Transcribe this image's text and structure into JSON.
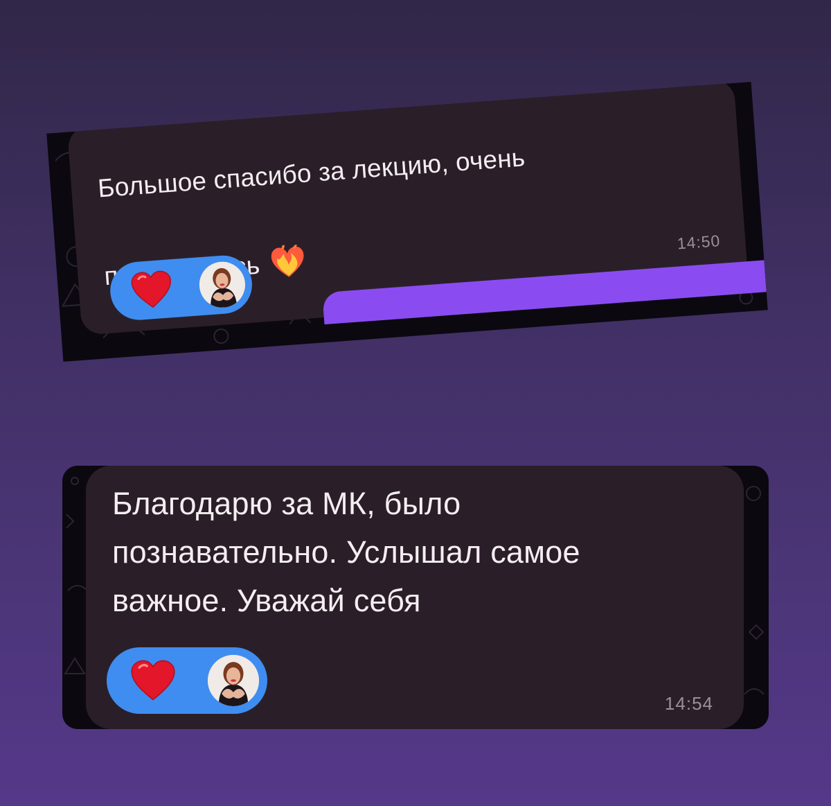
{
  "colors": {
    "background_top": "#312748",
    "background_bottom": "#55388a",
    "bubble": "#2a1f28",
    "message_text": "#f4eef2",
    "timestamp": "#9c8f98",
    "reaction_pill": "#3f8df0",
    "heart": "#e3162a",
    "accent_strip": "#8a4cf0"
  },
  "messages": [
    {
      "text": "Большое спасибо за лекцию, очень\nпонравилось",
      "emoji_icon": "heart-on-fire",
      "time": "14:50",
      "reaction": {
        "emoji_icon": "red-heart",
        "has_avatar": true
      }
    },
    {
      "text": "Благодарю за МК, было\nпознавательно. Услышал самое\nважное. Уважай себя",
      "time": "14:54",
      "reaction": {
        "emoji_icon": "red-heart",
        "has_avatar": true
      }
    }
  ]
}
